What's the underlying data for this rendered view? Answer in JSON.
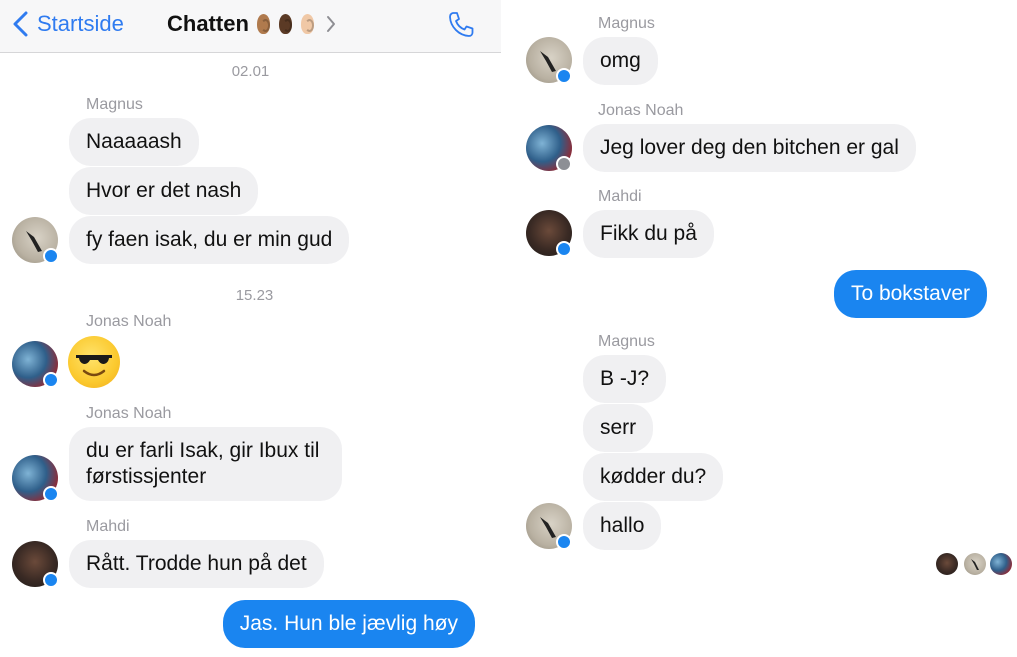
{
  "left": {
    "navbar": {
      "back_label": "Startside",
      "title": "Chatten",
      "ear_colors": [
        "#b07a4d",
        "#5b3a25",
        "#f0c8a6"
      ],
      "icons": [
        "back-chevron-icon",
        "chevron-right-icon",
        "phone-icon"
      ],
      "accent": "#2f7bf0"
    },
    "timestamps": [
      "02.01",
      "15.23"
    ],
    "messages": [
      {
        "sender": "Magnus",
        "texts": [
          "Naaaaash",
          "Hvor er det nash",
          "fy faen isak, du er min gud"
        ]
      },
      {
        "sender": "Jonas Noah",
        "emoji": "sunglasses-emoji"
      },
      {
        "sender": "Jonas Noah",
        "texts": [
          "du er farli Isak, gir Ibux til førstissjenter"
        ]
      },
      {
        "sender": "Mahdi",
        "texts": [
          "Rått. Trodde hun på det"
        ]
      }
    ],
    "outgoing": [
      "Jas. Hun ble jævlig høy"
    ]
  },
  "right": {
    "messages": [
      {
        "sender": "Magnus",
        "texts": [
          "omg"
        ]
      },
      {
        "sender": "Jonas Noah",
        "texts": [
          "Jeg lover deg den bitchen er gal"
        ]
      },
      {
        "sender": "Mahdi",
        "texts": [
          "Fikk du på"
        ]
      },
      {
        "sender": "Magnus",
        "texts": [
          "B -J?",
          "serr",
          "kødder du?",
          "hallo"
        ]
      }
    ],
    "outgoing": [
      "To bokstaver"
    ],
    "read_receipts": [
      "Mahdi",
      "Magnus",
      "Jonas Noah"
    ]
  },
  "colors": {
    "incoming_bubble": "#f0f0f2",
    "outgoing_bubble": "#1a85f0",
    "messenger_badge": "#1a85f0",
    "facebook_badge": "#8d8f95"
  }
}
